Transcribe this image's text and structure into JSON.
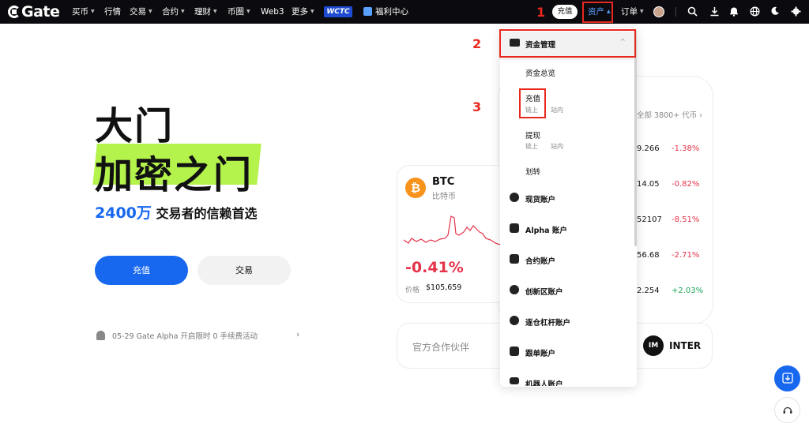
{
  "brand": {
    "name": "Gate"
  },
  "nav": {
    "buy_crypto": "买币",
    "markets": "行情",
    "trade": "交易",
    "futures": "合约",
    "earn": "理财",
    "square": "币圈",
    "web3": "Web3",
    "more": "更多",
    "wctc": "WCTC",
    "welfare": "福利中心",
    "deposit": "充值",
    "assets": "资产",
    "orders": "订单"
  },
  "annotations": {
    "n1": "1",
    "n2": "2",
    "n3": "3"
  },
  "hero": {
    "line1": "大门",
    "line2": "加密之门",
    "users_count": "2400万",
    "users_text": "交易者的信赖首选",
    "deposit_btn": "充值",
    "trade_btn": "交易",
    "notice": "05-29 Gate Alpha 开启限时 0 手续费活动"
  },
  "market": {
    "all_tokens": "全部 3800+ 代币",
    "rows": [
      {
        "price": "9.266",
        "change": "-1.38%"
      },
      {
        "price": "14.05",
        "change": "-0.82%"
      },
      {
        "price": "52107",
        "change": "-8.51%"
      },
      {
        "price": "56.68",
        "change": "-2.71%"
      },
      {
        "price": "2.254",
        "change": "+2.03%"
      }
    ]
  },
  "btc": {
    "symbol": "BTC",
    "name": "比特币",
    "change": "-0.41%",
    "price_label": "价格",
    "price": "$105,659"
  },
  "partner": {
    "label": "官方合作伙伴",
    "name": "INTER"
  },
  "dropdown": {
    "header": "资金管理",
    "overview": "资金总览",
    "deposit": "充值",
    "deposit_onchain": "链上",
    "deposit_internal": "站内",
    "withdraw": "提现",
    "withdraw_onchain": "链上",
    "withdraw_internal": "站内",
    "transfer": "划转",
    "spot": "现货账户",
    "alpha": "Alpha 账户",
    "futures": "合约账户",
    "innovation": "创新区账户",
    "margin": "逐仓杠杆账户",
    "copy": "跟单账户",
    "bot": "机器人账户"
  },
  "colors": {
    "accent": "#1768ef",
    "highlight": "#b4f24c",
    "annotation": "#e8281e",
    "down": "#e5334a",
    "up": "#1fa65b"
  }
}
